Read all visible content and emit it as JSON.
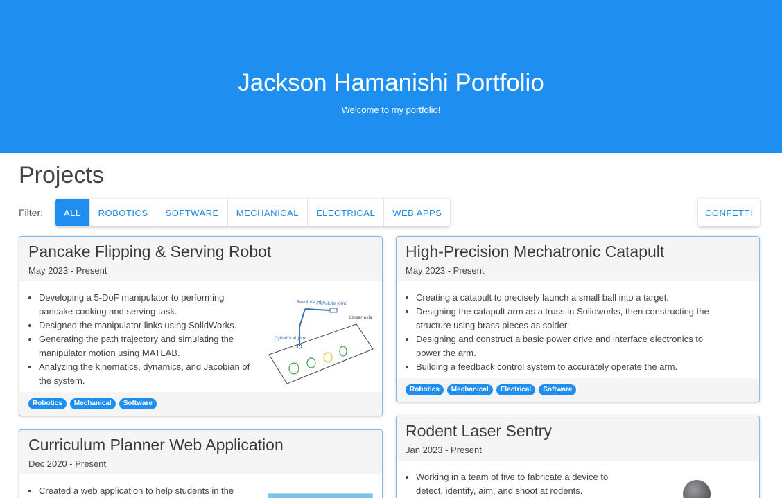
{
  "hero": {
    "title": "Jackson Hamanishi Portfolio",
    "subtitle": "Welcome to my portfolio!"
  },
  "projects": {
    "title": "Projects",
    "filter_label": "Filter:",
    "filters": [
      "ALL",
      "ROBOTICS",
      "SOFTWARE",
      "MECHANICAL",
      "ELECTRICAL",
      "WEB APPS"
    ],
    "active_filter": "ALL",
    "confetti_label": "CONFETTI"
  },
  "cards": {
    "pancake": {
      "title": "Pancake Flipping & Serving Robot",
      "date": "May 2023 - Present",
      "bullets": [
        "Developing a 5-DoF manipulator to performing pancake cooking and serving task.",
        "Designed the manipulator links using SolidWorks.",
        "Generating the path trajectory and simulating the manipulator motion using MATLAB.",
        "Analyzing the kinematics, dynamics, and Jacobian of the system."
      ],
      "sketch_labels": [
        "Revolute Joint",
        "Revolute Joint",
        "Linear axis",
        "Cylindrical Joint"
      ],
      "tags": [
        "Robotics",
        "Mechanical",
        "Software"
      ]
    },
    "catapult": {
      "title": "High-Precision Mechatronic Catapult",
      "date": "May 2023 - Present",
      "bullets": [
        "Creating a catapult to precisely launch a small ball into a target.",
        "Designing the catapult arm as a truss in Solidworks, then constructing the structure using brass pieces as solder.",
        "Designing and construct a basic power drive and interface electronics to power the arm.",
        "Building a feedback control system to accurately operate the arm."
      ],
      "tags": [
        "Robotics",
        "Mechanical",
        "Electrical",
        "Software"
      ]
    },
    "curriculum": {
      "title": "Curriculum Planner Web Application",
      "date": "Dec 2020 - Present",
      "bullets": [
        "Created a web application to help students in the"
      ]
    },
    "rodent": {
      "title": "Rodent Laser Sentry",
      "date": "Jan 2023 - Present",
      "bullets": [
        "Working in a team of five to fabricate a device to detect, identify, aim, and shoot at rodents."
      ]
    }
  },
  "colors": {
    "primary": "#1e8ff0",
    "card_border": "#8ab8e6",
    "card_header_bg": "#f5f5f5"
  }
}
